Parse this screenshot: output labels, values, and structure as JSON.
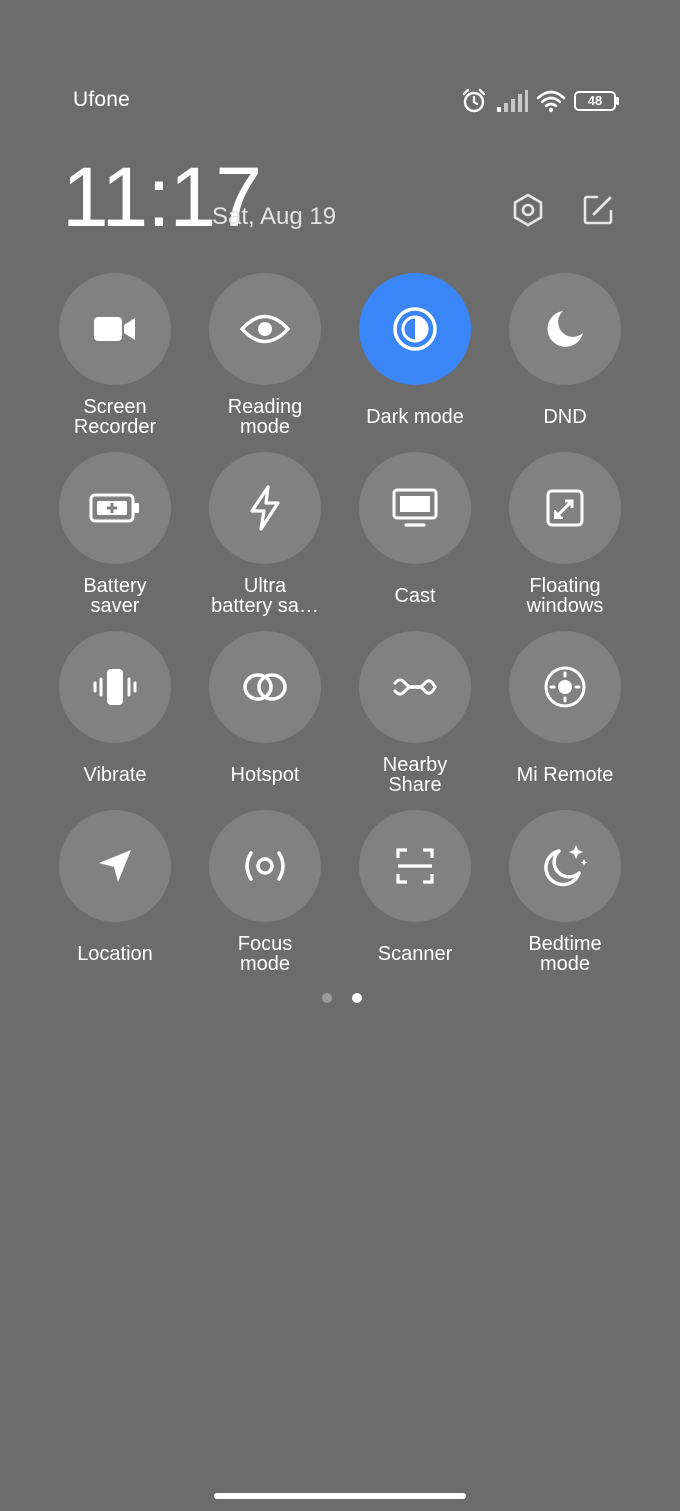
{
  "status_bar": {
    "carrier": "Ufone",
    "icons": [
      "alarm-icon",
      "signal-icon",
      "wifi-icon",
      "battery-icon"
    ],
    "battery_level": "48"
  },
  "header": {
    "time": "11:17",
    "date": "Sat, Aug 19",
    "icons": [
      "settings-icon",
      "edit-icon"
    ]
  },
  "accent_color": "#3a86f7",
  "tiles": [
    {
      "label": "Screen\nRecorder",
      "icon": "video-camera-icon",
      "active": false
    },
    {
      "label": "Reading\nmode",
      "icon": "eye-icon",
      "active": false
    },
    {
      "label": "Dark mode",
      "icon": "contrast-icon",
      "active": true
    },
    {
      "label": "DND",
      "icon": "moon-icon",
      "active": false
    },
    {
      "label": "Battery\nsaver",
      "icon": "battery-plus-icon",
      "active": false
    },
    {
      "label": "Ultra\nbattery sa…",
      "icon": "lightning-icon",
      "active": false
    },
    {
      "label": "Cast",
      "icon": "monitor-icon",
      "active": false
    },
    {
      "label": "Floating\nwindows",
      "icon": "floating-window-icon",
      "active": false
    },
    {
      "label": "Vibrate",
      "icon": "vibrate-icon",
      "active": false
    },
    {
      "label": "Hotspot",
      "icon": "hotspot-icon",
      "active": false
    },
    {
      "label": "Nearby\nShare",
      "icon": "nearby-share-icon",
      "active": false
    },
    {
      "label": "Mi Remote",
      "icon": "remote-icon",
      "active": false
    },
    {
      "label": "Location",
      "icon": "location-arrow-icon",
      "active": false
    },
    {
      "label": "Focus\nmode",
      "icon": "focus-icon",
      "active": false
    },
    {
      "label": "Scanner",
      "icon": "scanner-icon",
      "active": false
    },
    {
      "label": "Bedtime\nmode",
      "icon": "bedtime-moon-icon",
      "active": false
    }
  ],
  "pager": {
    "pages": 2,
    "current": 2
  }
}
